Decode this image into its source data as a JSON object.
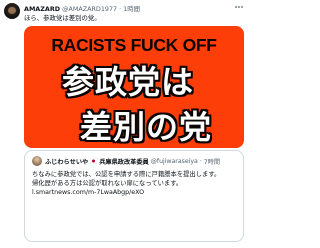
{
  "tweet": {
    "author_name": "AMAZARD",
    "author_handle": "@AMAZARD1977",
    "separator": "·",
    "time": "1時間",
    "text": "ほら、参政党は差別の党。",
    "media": {
      "line1": "RACISTS FUCK OFF",
      "line2": "参政党は",
      "line3": "差別の党",
      "background_color": "#fe3e08"
    },
    "quote": {
      "author_name": "ふじわらせいや",
      "author_affiliation": "兵庫県政改革委員",
      "author_handle": "@fujiwaraseiya",
      "separator": "·",
      "time": "7時間",
      "body_lines": [
        "ちなみに参政党では、公認を申請する際に戸籍謄本を提出します。",
        "帰化歴がある方は公認が取れない扉になっています。",
        "l.smartnews.com/m-7LwaAbgp/eXO"
      ]
    }
  },
  "icons": {
    "more": "more-horizontal-icon",
    "flag": "japan-flag-icon"
  }
}
